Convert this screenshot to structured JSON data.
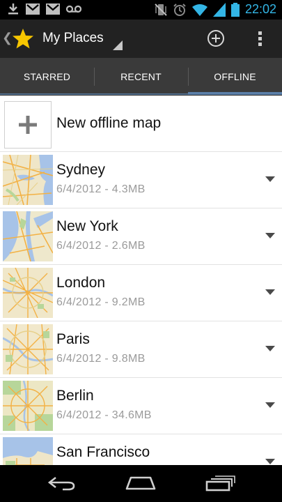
{
  "status_bar": {
    "icons": [
      "download-icon",
      "gmail-icon",
      "gmail-icon",
      "voicemail-icon",
      "vibrate-icon",
      "alarm-icon",
      "wifi-icon",
      "signal-icon",
      "battery-icon"
    ],
    "time": "22:02",
    "colors": {
      "time": "#33b5e5"
    }
  },
  "action_bar": {
    "title": "My Places",
    "icons": [
      "back-caret-icon",
      "star-icon",
      "spinner-arrow-icon",
      "add-icon",
      "overflow-menu-icon"
    ],
    "colors": {
      "background": "#222222",
      "star": "#f7c600"
    }
  },
  "tabs": [
    {
      "label": "STARRED",
      "selected": false
    },
    {
      "label": "RECENT",
      "selected": false
    },
    {
      "label": "OFFLINE",
      "selected": true
    }
  ],
  "tab_colors": {
    "indicator": "#5b7fa8",
    "background": "#3a3a3a"
  },
  "new_map": {
    "label": "New offline map",
    "icon": "plus-icon"
  },
  "maps": [
    {
      "city": "Sydney",
      "meta": "6/4/2012 - 4.3MB"
    },
    {
      "city": "New York",
      "meta": "6/4/2012 - 2.6MB"
    },
    {
      "city": "London",
      "meta": "6/4/2012 - 9.2MB"
    },
    {
      "city": "Paris",
      "meta": "6/4/2012 - 9.8MB"
    },
    {
      "city": "Berlin",
      "meta": "6/4/2012 - 34.6MB"
    },
    {
      "city": "San Francisco",
      "meta": ""
    }
  ],
  "nav_bar": {
    "icons": [
      "back-icon",
      "home-icon",
      "recent-apps-icon"
    ]
  }
}
